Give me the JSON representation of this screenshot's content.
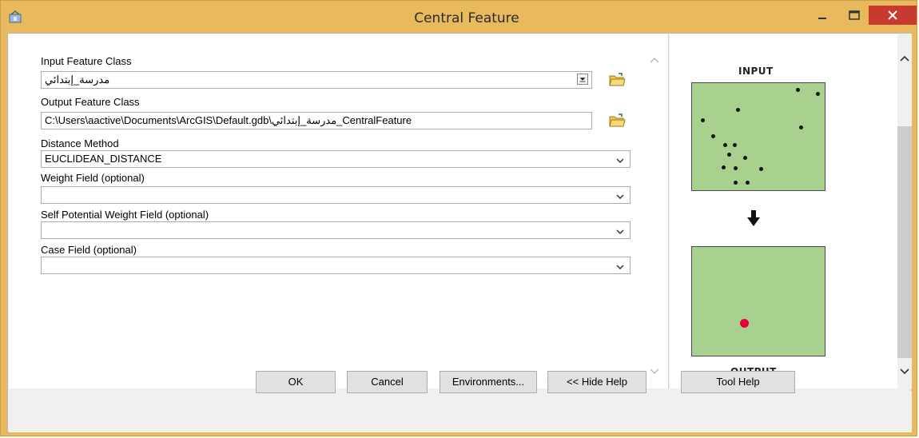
{
  "window": {
    "title": "Central Feature",
    "close_label": "×"
  },
  "form": {
    "input_feature_class": {
      "label": "Input Feature Class",
      "value": "مدرسة_إبتدائي"
    },
    "output_feature_class": {
      "label": "Output Feature Class",
      "value": "C:\\Users\\aactive\\Documents\\ArcGIS\\Default.gdb\\مدرسة_إبتدائي_CentralFeature"
    },
    "distance_method": {
      "label": "Distance Method",
      "value": "EUCLIDEAN_DISTANCE"
    },
    "weight_field": {
      "label": "Weight Field (optional)",
      "value": ""
    },
    "self_potential_weight_field": {
      "label": "Self Potential Weight Field (optional)",
      "value": ""
    },
    "case_field": {
      "label": "Case Field (optional)",
      "value": ""
    }
  },
  "help": {
    "input_label": "INPUT",
    "output_label": "OUTPUT"
  },
  "buttons": {
    "ok": "OK",
    "cancel": "Cancel",
    "environments": "Environments...",
    "hide_help": "<< Hide Help",
    "tool_help": "Tool Help"
  }
}
